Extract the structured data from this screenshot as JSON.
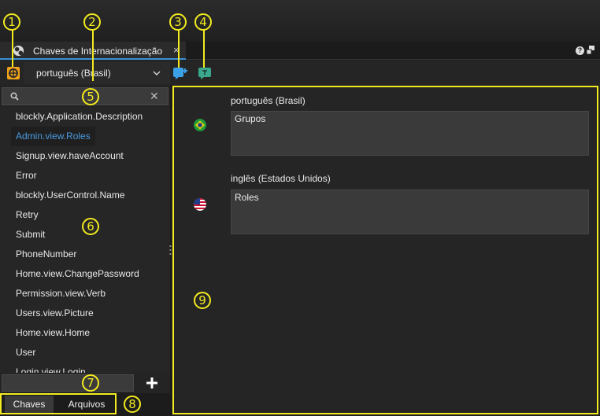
{
  "window": {
    "tab_title": "Chaves de Internacionalização",
    "tab_close": "×",
    "help_label": "?"
  },
  "toolbar": {
    "selected_language": "português (Brasil)"
  },
  "search": {
    "value": "",
    "placeholder": "",
    "clear_label": "✕"
  },
  "key_list": {
    "items": [
      {
        "label": "blockly.Application.Description",
        "selected": false
      },
      {
        "label": "Admin.view.Roles",
        "selected": true
      },
      {
        "label": "Signup.view.haveAccount",
        "selected": false
      },
      {
        "label": "Error",
        "selected": false
      },
      {
        "label": "blockly.UserControl.Name",
        "selected": false
      },
      {
        "label": "Retry",
        "selected": false
      },
      {
        "label": "Submit",
        "selected": false
      },
      {
        "label": "PhoneNumber",
        "selected": false
      },
      {
        "label": "Home.view.ChangePassword",
        "selected": false
      },
      {
        "label": "Permission.view.Verb",
        "selected": false
      },
      {
        "label": "Users.view.Picture",
        "selected": false
      },
      {
        "label": "Home.view.Home",
        "selected": false
      },
      {
        "label": "User",
        "selected": false
      },
      {
        "label": "Login.view.Login",
        "selected": false
      }
    ]
  },
  "bottom_tabs": {
    "keys_label": "Chaves",
    "files_label": "Arquivos"
  },
  "translations": [
    {
      "language": "português (Brasil)",
      "flag": "brazil-flag-icon",
      "value": "Grupos"
    },
    {
      "language": "inglês (Estados Unidos)",
      "flag": "usa-flag-icon",
      "value": "Roles"
    }
  ],
  "callouts": {
    "labels": [
      "1",
      "2",
      "3",
      "4",
      "5",
      "6",
      "7",
      "8",
      "9"
    ],
    "color": "#f2ea1f"
  },
  "colors": {
    "accent": "#3a8fd8",
    "selected_key": "#4a9be0",
    "add_icon": "#3aa0e8",
    "translate_icon": "#3aa88c",
    "lang_icon": "#f0a21a"
  }
}
